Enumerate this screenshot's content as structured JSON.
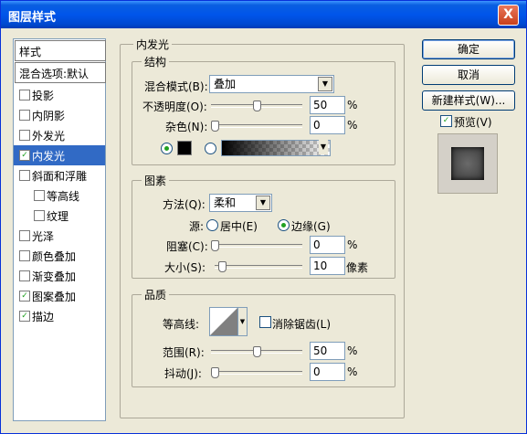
{
  "window": {
    "title": "图层样式",
    "close_glyph": "X"
  },
  "left_list": {
    "header": "样式",
    "blend_default": "混合选项:默认",
    "items": [
      {
        "label": "投影",
        "checked": false,
        "selected": false,
        "indent": false
      },
      {
        "label": "内阴影",
        "checked": false,
        "selected": false,
        "indent": false
      },
      {
        "label": "外发光",
        "checked": false,
        "selected": false,
        "indent": false
      },
      {
        "label": "内发光",
        "checked": true,
        "selected": true,
        "indent": false
      },
      {
        "label": "斜面和浮雕",
        "checked": false,
        "selected": false,
        "indent": false
      },
      {
        "label": "等高线",
        "checked": false,
        "selected": false,
        "indent": true
      },
      {
        "label": "纹理",
        "checked": false,
        "selected": false,
        "indent": true
      },
      {
        "label": "光泽",
        "checked": false,
        "selected": false,
        "indent": false
      },
      {
        "label": "颜色叠加",
        "checked": false,
        "selected": false,
        "indent": false
      },
      {
        "label": "渐变叠加",
        "checked": false,
        "selected": false,
        "indent": false
      },
      {
        "label": "图案叠加",
        "checked": true,
        "selected": false,
        "indent": false
      },
      {
        "label": "描边",
        "checked": true,
        "selected": false,
        "indent": false
      }
    ]
  },
  "main": {
    "section_title": "内发光",
    "structure": {
      "title": "结构",
      "blend_mode_label": "混合模式(B):",
      "blend_mode_value": "叠加",
      "opacity_label": "不透明度(O):",
      "opacity_value": "50",
      "opacity_percent": 0.5,
      "noise_label": "杂色(N):",
      "noise_value": "0",
      "noise_percent": 0,
      "percent_sign": "%"
    },
    "elements": {
      "title": "图素",
      "method_label": "方法(Q):",
      "method_value": "柔和",
      "source_label": "源:",
      "source_center": "居中(E)",
      "source_edge": "边缘(G)",
      "choke_label": "阻塞(C):",
      "choke_value": "0",
      "choke_percent": 0,
      "size_label": "大小(S):",
      "size_value": "10",
      "size_percent": 0.04,
      "size_unit": "像素",
      "percent_sign": "%"
    },
    "quality": {
      "title": "品质",
      "contour_label": "等高线:",
      "antialias_label": "消除锯齿(L)",
      "range_label": "范围(R):",
      "range_value": "50",
      "range_percent": 0.5,
      "jitter_label": "抖动(J):",
      "jitter_value": "0",
      "jitter_percent": 0,
      "percent_sign": "%"
    }
  },
  "right": {
    "ok": "确定",
    "cancel": "取消",
    "new_style": "新建样式(W)...",
    "preview_label": "预览(V)"
  },
  "colors": {
    "title_bar": "#0055ea",
    "selection": "#316ac5",
    "glow_color": "#000000"
  }
}
